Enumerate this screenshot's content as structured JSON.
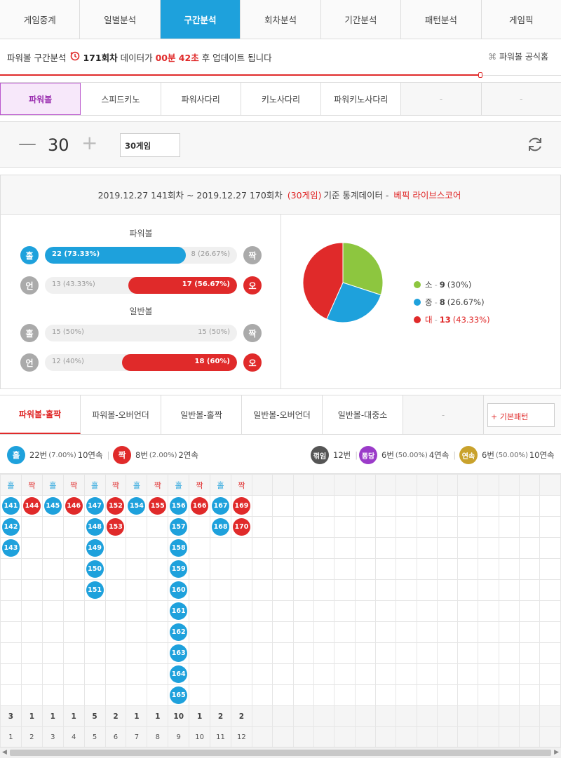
{
  "top_tabs": [
    "게임중계",
    "일별분석",
    "구간분석",
    "회차분석",
    "기간분석",
    "패턴분석",
    "게임픽"
  ],
  "info": {
    "prefix": "파워볼 구간분석",
    "round": "171회차",
    "text1": "데이터가",
    "time": "00분 42초",
    "text2": "후 업데이트 됩니다",
    "home_label": "파워볼 공식홈"
  },
  "game_tabs": [
    "파워볼",
    "스피드키노",
    "파워사다리",
    "키노사다리",
    "파워키노사다리",
    "-",
    "-"
  ],
  "counter": {
    "value": "30",
    "select_label": "30게임"
  },
  "stats_header": {
    "range": "2019.12.27 141회차 ~ 2019.12.27 170회차",
    "games": "(30게임)",
    "suffix": "기준 통계데이터 -",
    "brand": "베픽 라이브스코어"
  },
  "powerball": {
    "title": "파워볼",
    "odd": {
      "left": "홀",
      "right": "짝",
      "left_label": "22 (73.33%)",
      "right_label": "8 (26.67%)",
      "fraction": 0.7333,
      "side": "left"
    },
    "under": {
      "left": "언",
      "right": "오",
      "left_label": "13 (43.33%)",
      "right_label": "17 (56.67%)",
      "fraction": 0.5667,
      "side": "right"
    }
  },
  "normalball": {
    "title": "일반볼",
    "odd": {
      "left": "홀",
      "right": "짝",
      "left_label": "15 (50%)",
      "right_label": "15 (50%)",
      "fraction": 0,
      "side": "none"
    },
    "under": {
      "left": "언",
      "right": "오",
      "left_label": "12 (40%)",
      "right_label": "18 (60%)",
      "fraction": 0.6,
      "side": "right"
    }
  },
  "chart_data": {
    "type": "pie",
    "slices": [
      {
        "label": "소",
        "value": 9,
        "pct": "(30%)",
        "color": "#8dc63f"
      },
      {
        "label": "중",
        "value": 8,
        "pct": "(26.67%)",
        "color": "#1ea1dc"
      },
      {
        "label": "대",
        "value": 13,
        "pct": "(43.33%)",
        "color": "#e02a2a"
      }
    ]
  },
  "pattern_tabs": [
    "파워볼-홀짝",
    "파워볼-오버언더",
    "일반볼-홀짝",
    "일반볼-오버언더",
    "일반볼-대중소",
    "-"
  ],
  "basic_pattern_label": "+ 기본패턴",
  "summary": {
    "odd": {
      "badge": "홀",
      "count": "22번",
      "pct": "(7.00%)",
      "streak": "10연속"
    },
    "even": {
      "badge": "짝",
      "count": "8번",
      "pct": "(2.00%)",
      "streak": "2연속"
    },
    "broken": {
      "badge": "꺾임",
      "count": "12번"
    },
    "bounce": {
      "badge": "퐁당",
      "count": "6번",
      "pct": "(50.00%)",
      "streak": "4연속"
    },
    "cont": {
      "badge": "연속",
      "count": "6번",
      "pct": "(50.00%)",
      "streak": "10연속"
    }
  },
  "grid": {
    "columns": [
      {
        "head": "홀",
        "kind": "odd",
        "balls": [
          "141",
          "142",
          "143"
        ],
        "count": "3",
        "index": "1"
      },
      {
        "head": "짝",
        "kind": "even",
        "balls": [
          "144"
        ],
        "count": "1",
        "index": "2"
      },
      {
        "head": "홀",
        "kind": "odd",
        "balls": [
          "145"
        ],
        "count": "1",
        "index": "3"
      },
      {
        "head": "짝",
        "kind": "even",
        "balls": [
          "146"
        ],
        "count": "1",
        "index": "4"
      },
      {
        "head": "홀",
        "kind": "odd",
        "balls": [
          "147",
          "148",
          "149",
          "150",
          "151"
        ],
        "count": "5",
        "index": "5"
      },
      {
        "head": "짝",
        "kind": "even",
        "balls": [
          "152",
          "153"
        ],
        "count": "2",
        "index": "6"
      },
      {
        "head": "홀",
        "kind": "odd",
        "balls": [
          "154"
        ],
        "count": "1",
        "index": "7"
      },
      {
        "head": "짝",
        "kind": "even",
        "balls": [
          "155"
        ],
        "count": "1",
        "index": "8"
      },
      {
        "head": "홀",
        "kind": "odd",
        "balls": [
          "156",
          "157",
          "158",
          "159",
          "160",
          "161",
          "162",
          "163",
          "164",
          "165"
        ],
        "count": "10",
        "index": "9"
      },
      {
        "head": "짝",
        "kind": "even",
        "balls": [
          "166"
        ],
        "count": "1",
        "index": "10"
      },
      {
        "head": "홀",
        "kind": "odd",
        "balls": [
          "167",
          "168"
        ],
        "count": "2",
        "index": "11"
      },
      {
        "head": "짝",
        "kind": "even",
        "balls": [
          "169",
          "170"
        ],
        "count": "2",
        "index": "12"
      }
    ],
    "colors": {
      "odd": "#1ea1dc",
      "even": "#e02a2a"
    }
  }
}
